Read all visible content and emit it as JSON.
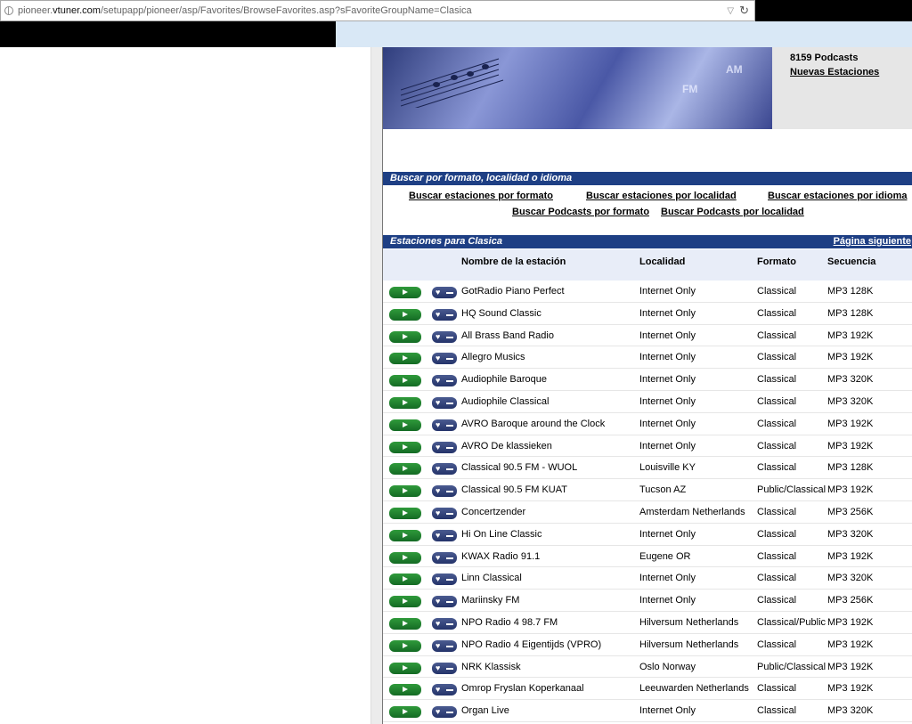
{
  "browser": {
    "url_prefix": "pioneer.",
    "url_domain": "vtuner.com",
    "url_path": "/setupapp/pioneer/asp/Favorites/BrowseFavorites.asp?sFavoriteGroupName=Clasica"
  },
  "header": {
    "podcasts": "8159  Podcasts",
    "nuevas": "Nuevas Estaciones",
    "banner_fm": "FM",
    "banner_am": "AM"
  },
  "search": {
    "title": "Buscar por formato, localidad o idioma",
    "links": [
      "Buscar estaciones por formato",
      "Buscar estaciones por localidad",
      "Buscar estaciones por idioma",
      "Buscar Podcasts por formato",
      "Buscar Podcasts por localidad"
    ]
  },
  "stations": {
    "title": "Estaciones para Clasica",
    "next_page": "Página siguiente",
    "columns": [
      "Nombre de la estación",
      "Localidad",
      "Formato",
      "Secuencia"
    ],
    "rows": [
      {
        "name": "GotRadio Piano Perfect",
        "loc": "Internet Only",
        "fmt": "Classical",
        "seq": "MP3 128K"
      },
      {
        "name": "HQ Sound Classic",
        "loc": "Internet Only",
        "fmt": "Classical",
        "seq": "MP3 128K"
      },
      {
        "name": "All Brass Band Radio",
        "loc": "Internet Only",
        "fmt": "Classical",
        "seq": "MP3 192K"
      },
      {
        "name": "Allegro Musics",
        "loc": "Internet Only",
        "fmt": "Classical",
        "seq": "MP3 192K"
      },
      {
        "name": "Audiophile Baroque",
        "loc": "Internet Only",
        "fmt": "Classical",
        "seq": "MP3 320K"
      },
      {
        "name": "Audiophile Classical",
        "loc": "Internet Only",
        "fmt": "Classical",
        "seq": "MP3 320K"
      },
      {
        "name": "AVRO Baroque around the Clock",
        "loc": "Internet Only",
        "fmt": "Classical",
        "seq": "MP3 192K"
      },
      {
        "name": "AVRO De klassieken",
        "loc": "Internet Only",
        "fmt": "Classical",
        "seq": "MP3 192K"
      },
      {
        "name": "Classical 90.5 FM - WUOL",
        "loc": "Louisville KY",
        "fmt": "Classical",
        "seq": "MP3 128K"
      },
      {
        "name": "Classical 90.5 FM KUAT",
        "loc": "Tucson AZ",
        "fmt": "Public/Classical",
        "seq": "MP3 192K"
      },
      {
        "name": "Concertzender",
        "loc": "Amsterdam Netherlands",
        "fmt": "Classical",
        "seq": "MP3 256K"
      },
      {
        "name": "Hi On Line Classic",
        "loc": "Internet Only",
        "fmt": "Classical",
        "seq": "MP3 320K"
      },
      {
        "name": "KWAX Radio 91.1",
        "loc": "Eugene OR",
        "fmt": "Classical",
        "seq": "MP3 192K"
      },
      {
        "name": "Linn Classical",
        "loc": "Internet Only",
        "fmt": "Classical",
        "seq": "MP3 320K"
      },
      {
        "name": "Mariinsky FM",
        "loc": "Internet Only",
        "fmt": "Classical",
        "seq": "MP3 256K"
      },
      {
        "name": "NPO Radio 4 98.7 FM",
        "loc": "Hilversum Netherlands",
        "fmt": "Classical/Public",
        "seq": "MP3 192K"
      },
      {
        "name": "NPO Radio 4 Eigentijds (VPRO)",
        "loc": "Hilversum Netherlands",
        "fmt": "Classical",
        "seq": "MP3 192K"
      },
      {
        "name": "NRK Klassisk",
        "loc": "Oslo Norway",
        "fmt": "Public/Classical",
        "seq": "MP3 192K"
      },
      {
        "name": "Omrop Fryslan Koperkanaal",
        "loc": "Leeuwarden Netherlands",
        "fmt": "Classical",
        "seq": "MP3 192K"
      },
      {
        "name": "Organ Live",
        "loc": "Internet Only",
        "fmt": "Classical",
        "seq": "MP3 320K"
      }
    ]
  }
}
